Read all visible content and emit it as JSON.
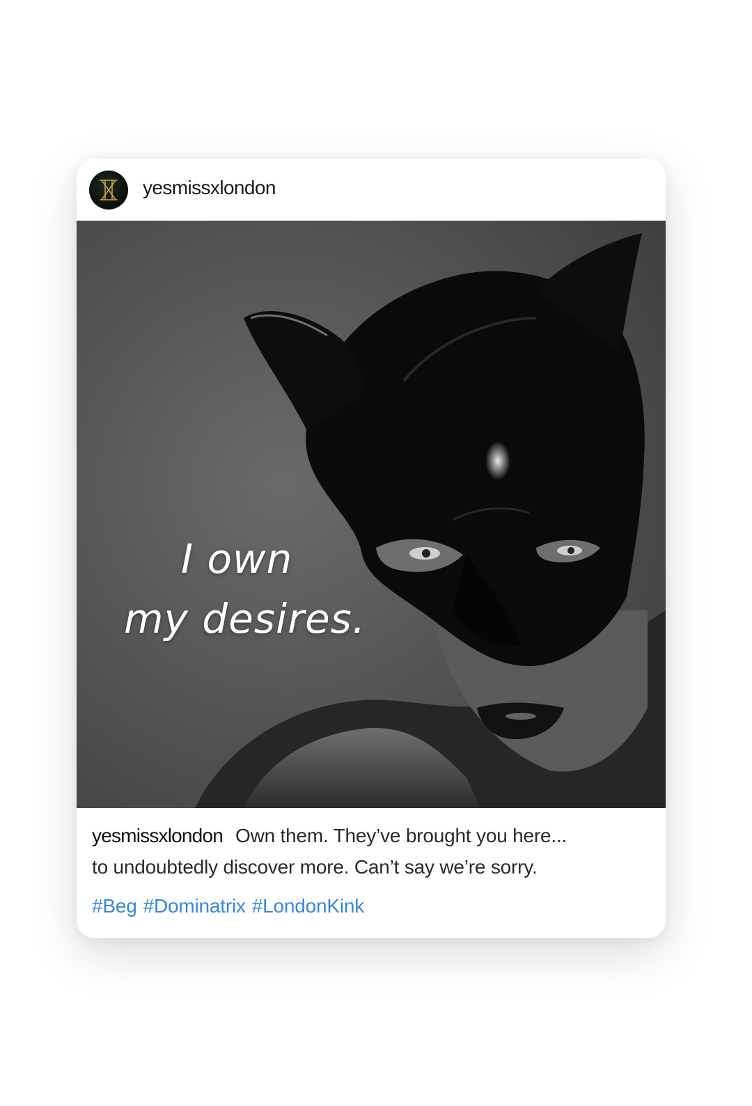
{
  "post": {
    "username": "yesmissxlondon",
    "avatar_icon": "gold-monogram-logo-icon",
    "image": {
      "overlay_line1": "I own",
      "overlay_line2": "my desires."
    },
    "caption": {
      "username": "yesmissxlondon",
      "line1": "Own them. They’ve brought you here...",
      "line2": "to undoubtedly discover more. Can’t say we’re sorry."
    },
    "hashtags": [
      "#Beg",
      "#Dominatrix",
      "#LondonKink"
    ],
    "colors": {
      "hashtag": "#3b86d6",
      "text": "#2a2a2a",
      "logo_gold": "#c9a24a",
      "card_bg": "#ffffff"
    }
  }
}
